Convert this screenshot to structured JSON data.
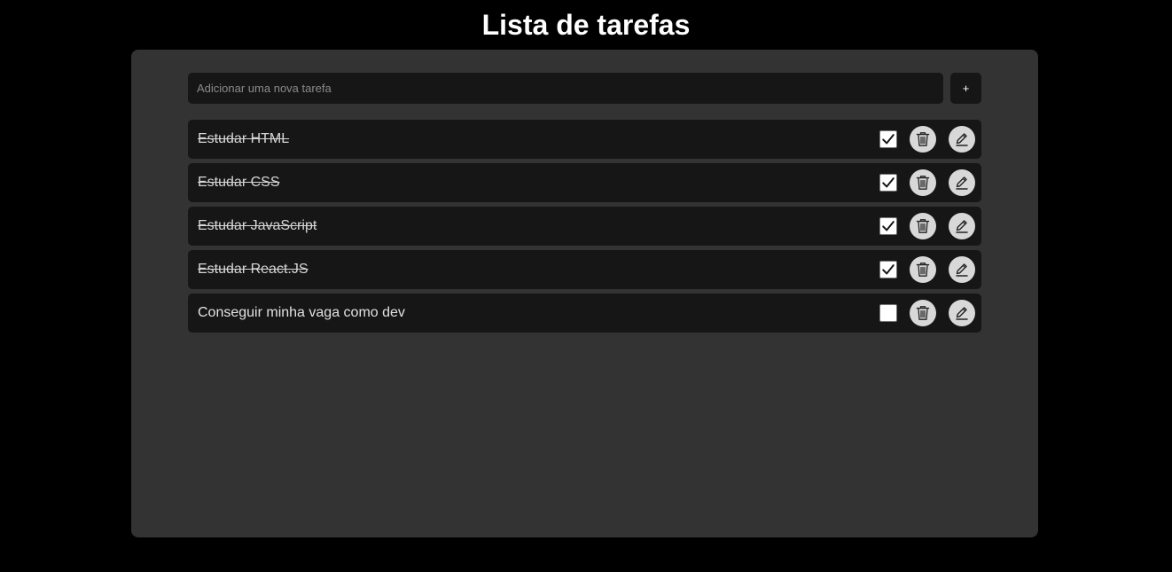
{
  "header": {
    "title": "Lista de tarefas"
  },
  "new_task": {
    "placeholder": "Adicionar uma nova tarefa",
    "value": "",
    "add_label": "+"
  },
  "tasks": [
    {
      "text": "Estudar HTML",
      "done": true
    },
    {
      "text": "Estudar CSS",
      "done": true
    },
    {
      "text": "Estudar JavaScript",
      "done": true
    },
    {
      "text": "Estudar React.JS",
      "done": true
    },
    {
      "text": "Conseguir minha vaga como dev",
      "done": false
    }
  ],
  "icons": {
    "checkbox": "checkmark-icon",
    "delete": "trash-icon",
    "edit": "pencil-icon"
  },
  "colors": {
    "background": "#000000",
    "panel": "#333333",
    "item": "#161616",
    "title": "#ffffff",
    "task_text": "#e2e2e2",
    "button": "#d8d8d8"
  }
}
